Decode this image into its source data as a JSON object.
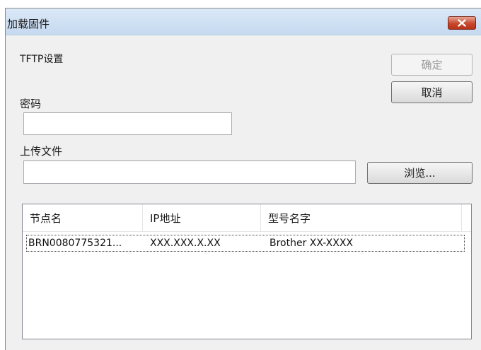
{
  "window": {
    "title": "加载固件"
  },
  "tftp": {
    "section_label": "TFTP设置"
  },
  "password": {
    "label": "密码",
    "value": ""
  },
  "upload": {
    "label": "上传文件",
    "value": ""
  },
  "buttons": {
    "ok": "确定",
    "cancel": "取消",
    "browse": "浏览..."
  },
  "table": {
    "columns": [
      "节点名",
      "IP地址",
      "型号名字"
    ],
    "rows": [
      {
        "node": "BRN0080775321...",
        "ip": "XXX.XXX.X.XX",
        "model": "Brother XX-XXXX"
      }
    ]
  }
}
